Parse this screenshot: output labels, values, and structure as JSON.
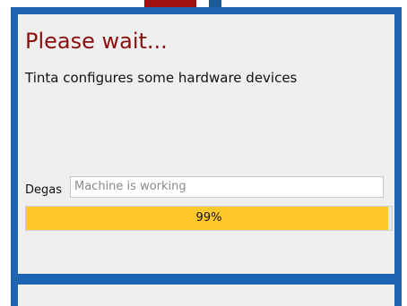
{
  "dialog": {
    "title": "Please wait...",
    "message": "Tinta configures some hardware devices"
  },
  "status_field": {
    "label": "Degas",
    "value": "Machine is working"
  },
  "progress": {
    "percent": 99,
    "text": "99%"
  },
  "colors": {
    "frame": "#1e64b0",
    "title": "#8b0f0f",
    "progress_fill": "#ffc92e"
  }
}
